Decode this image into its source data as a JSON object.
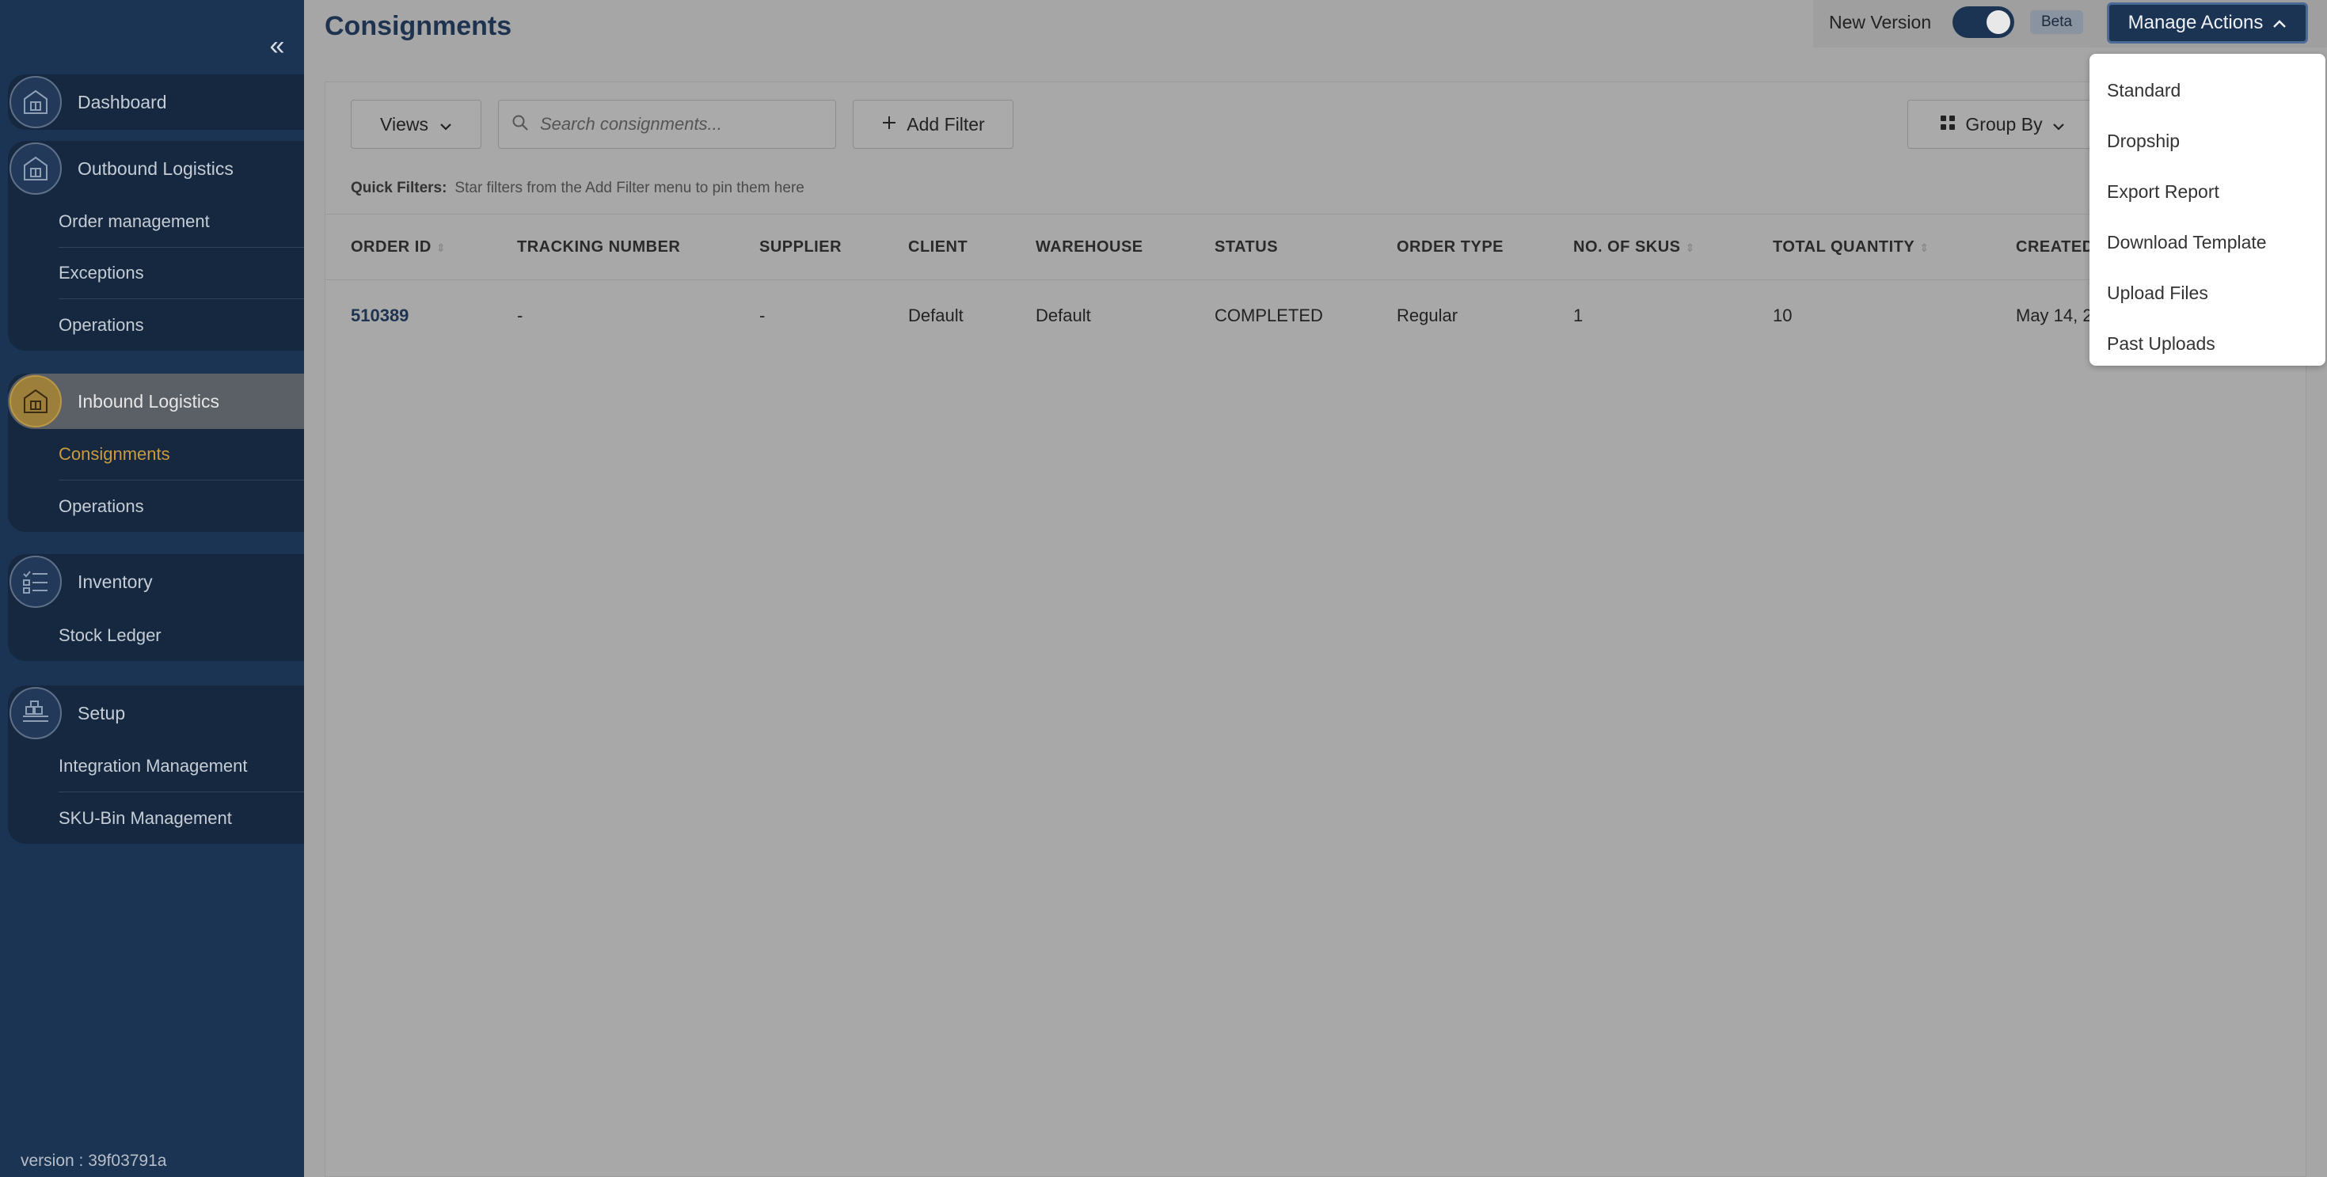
{
  "sidebar": {
    "collapse_icon": "«",
    "groups": [
      {
        "title": "Dashboard",
        "icon": "building-icon",
        "items": []
      },
      {
        "title": "Outbound Logistics",
        "icon": "building-icon",
        "items": [
          "Order management",
          "Exceptions",
          "Operations"
        ]
      },
      {
        "title": "Inbound Logistics",
        "icon": "building-icon",
        "items": [
          "Consignments",
          "Operations"
        ]
      },
      {
        "title": "Inventory",
        "icon": "checklist-icon",
        "items": [
          "Stock Ledger"
        ]
      },
      {
        "title": "Setup",
        "icon": "pallet-icon",
        "items": [
          "Integration Management",
          "SKU-Bin Management"
        ]
      }
    ],
    "version": "version : 39f03791a"
  },
  "header": {
    "title": "Consignments",
    "new_version_label": "New Version",
    "beta_label": "Beta",
    "manage_actions_label": "Manage Actions"
  },
  "toolbar": {
    "views_label": "Views",
    "search_placeholder": "Search consignments...",
    "add_filter_label": "Add Filter",
    "group_by_label": "Group By"
  },
  "quick_filters": {
    "label": "Quick Filters:",
    "hint": "Star filters from the Add Filter menu to pin them here"
  },
  "table": {
    "columns": [
      "ORDER ID",
      "TRACKING NUMBER",
      "SUPPLIER",
      "CLIENT",
      "WAREHOUSE",
      "STATUS",
      "ORDER TYPE",
      "NO. OF SKUS",
      "TOTAL QUANTITY",
      "CREATED"
    ],
    "rows": [
      [
        "510389",
        "-",
        "-",
        "Default",
        "Default",
        "COMPLETED",
        "Regular",
        "1",
        "10",
        "May 14, 2"
      ]
    ]
  },
  "manage_menu": {
    "items": [
      "Standard",
      "Dropship",
      "Export Report",
      "Download Template",
      "Upload Files",
      "Past Uploads"
    ]
  },
  "colors": {
    "sidebar": "#1c3453",
    "accent_gold": "#c99b3c",
    "overlay_gray": "#a6a6a6"
  }
}
